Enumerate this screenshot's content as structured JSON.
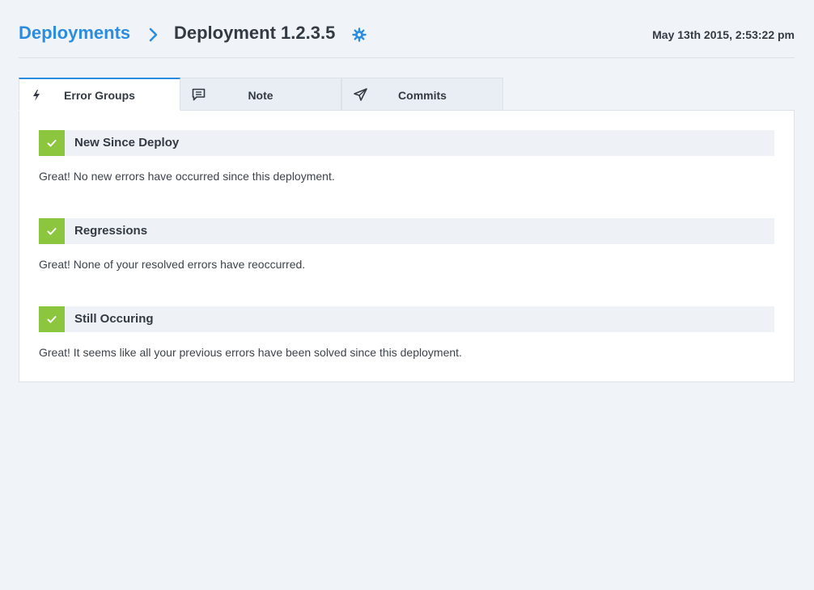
{
  "header": {
    "breadcrumb": "Deployments",
    "title": "Deployment 1.2.3.5",
    "date": "May 13th 2015, 2:53:22 pm"
  },
  "tabs": [
    {
      "label": "Error Groups",
      "icon": "lightning-icon",
      "active": true
    },
    {
      "label": "Note",
      "icon": "comment-icon",
      "active": false
    },
    {
      "label": "Commits",
      "icon": "paper-plane-icon",
      "active": false
    }
  ],
  "sections": [
    {
      "title": "New Since Deploy",
      "message": "Great! No new errors have occurred since this deployment."
    },
    {
      "title": "Regressions",
      "message": "Great! None of your resolved errors have reoccurred."
    },
    {
      "title": "Still Occuring",
      "message": "Great! It seems like all your previous errors have been solved since this deployment."
    }
  ],
  "colors": {
    "accent": "#2b8de0",
    "success": "#8cc63f",
    "background": "#f0f3f8",
    "text": "#333a42"
  }
}
